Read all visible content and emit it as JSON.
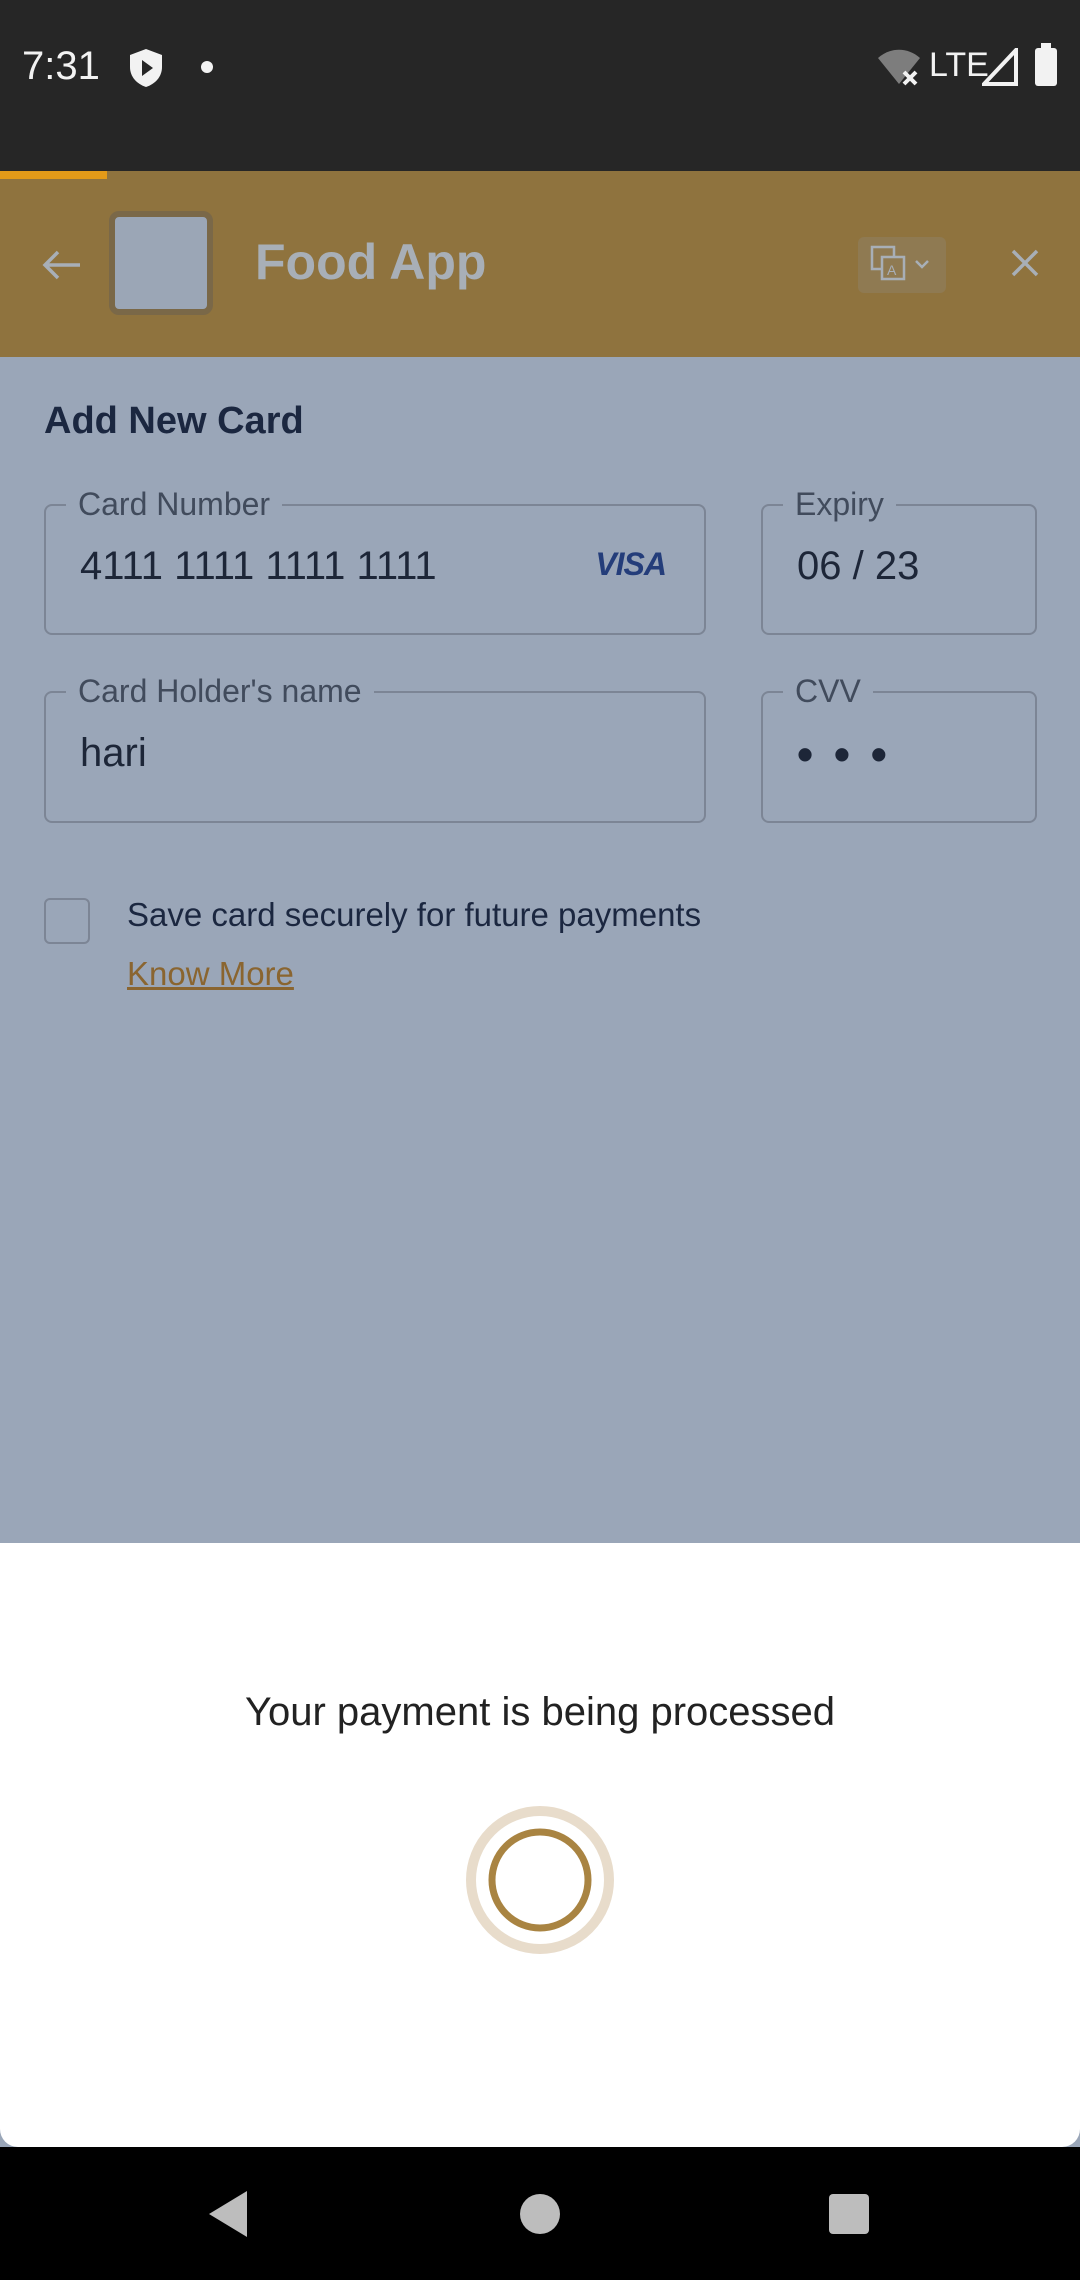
{
  "status_bar": {
    "time": "7:31",
    "network": "LTE"
  },
  "header": {
    "title": "Food App",
    "accent_color": "#8f733e",
    "progress_color": "#e39a18"
  },
  "form": {
    "title": "Add New Card",
    "card_number": {
      "label": "Card Number",
      "value": "4111 1111 1111 1111",
      "brand": "VISA"
    },
    "expiry": {
      "label": "Expiry",
      "value": "06 / 23"
    },
    "holder": {
      "label": "Card Holder's name",
      "value": "hari"
    },
    "cvv": {
      "label": "CVV",
      "value": "• • •"
    },
    "save_card": {
      "label": "Save card securely for future payments",
      "checked": false
    },
    "know_more": "Know More"
  },
  "sheet": {
    "message": "Your payment is being processed"
  },
  "icons": {
    "back": "arrow-left-icon",
    "close": "close-icon",
    "language": "translate-icon",
    "spinner": "loading-spinner-icon"
  }
}
